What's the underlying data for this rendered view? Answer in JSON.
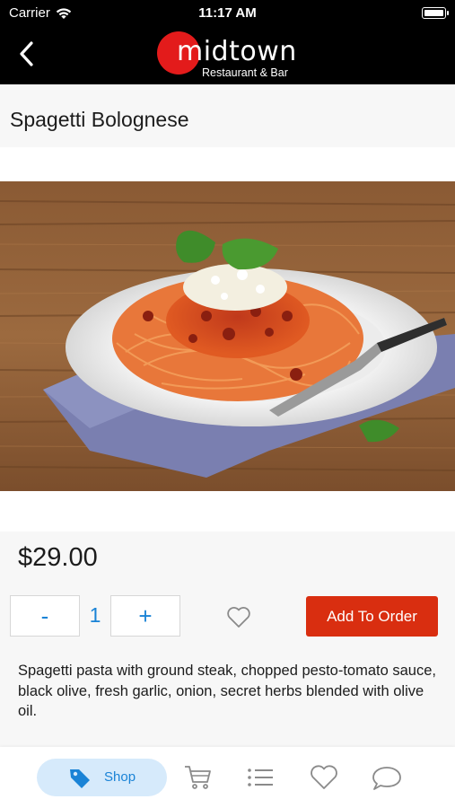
{
  "status_bar": {
    "carrier": "Carrier",
    "time": "11:17 AM",
    "battery_level": 1.0
  },
  "header": {
    "back_icon": "chevron-left-icon",
    "logo_wordmark": "midtown",
    "logo_subtitle": "Restaurant & Bar",
    "logo_color": "#e31b1b"
  },
  "product": {
    "name": "Spagetti Bolognese",
    "image": "photo of spaghetti bolognese on a white plate",
    "price": "$29.00",
    "quantity": "1",
    "decrement_label": "-",
    "increment_label": "+",
    "favorite_icon": "heart-outline-icon",
    "add_button_label": "Add To Order",
    "description": "Spagetti pasta with ground steak, chopped pesto-tomato sauce, black olive, fresh garlic, onion, secret herbs blended with olive oil."
  },
  "tab_bar": {
    "active_tab": "Shop",
    "shop_label": "Shop",
    "shop_icon": "tag-icon",
    "icons": [
      "cart-icon",
      "list-icon",
      "heart-icon",
      "chat-bubble-icon"
    ],
    "accent_color": "#1a83d6",
    "active_background": "#d6eafb"
  },
  "colors": {
    "header_background": "#000000",
    "add_button": "#d92e10",
    "quantity_text": "#1a83d6"
  }
}
